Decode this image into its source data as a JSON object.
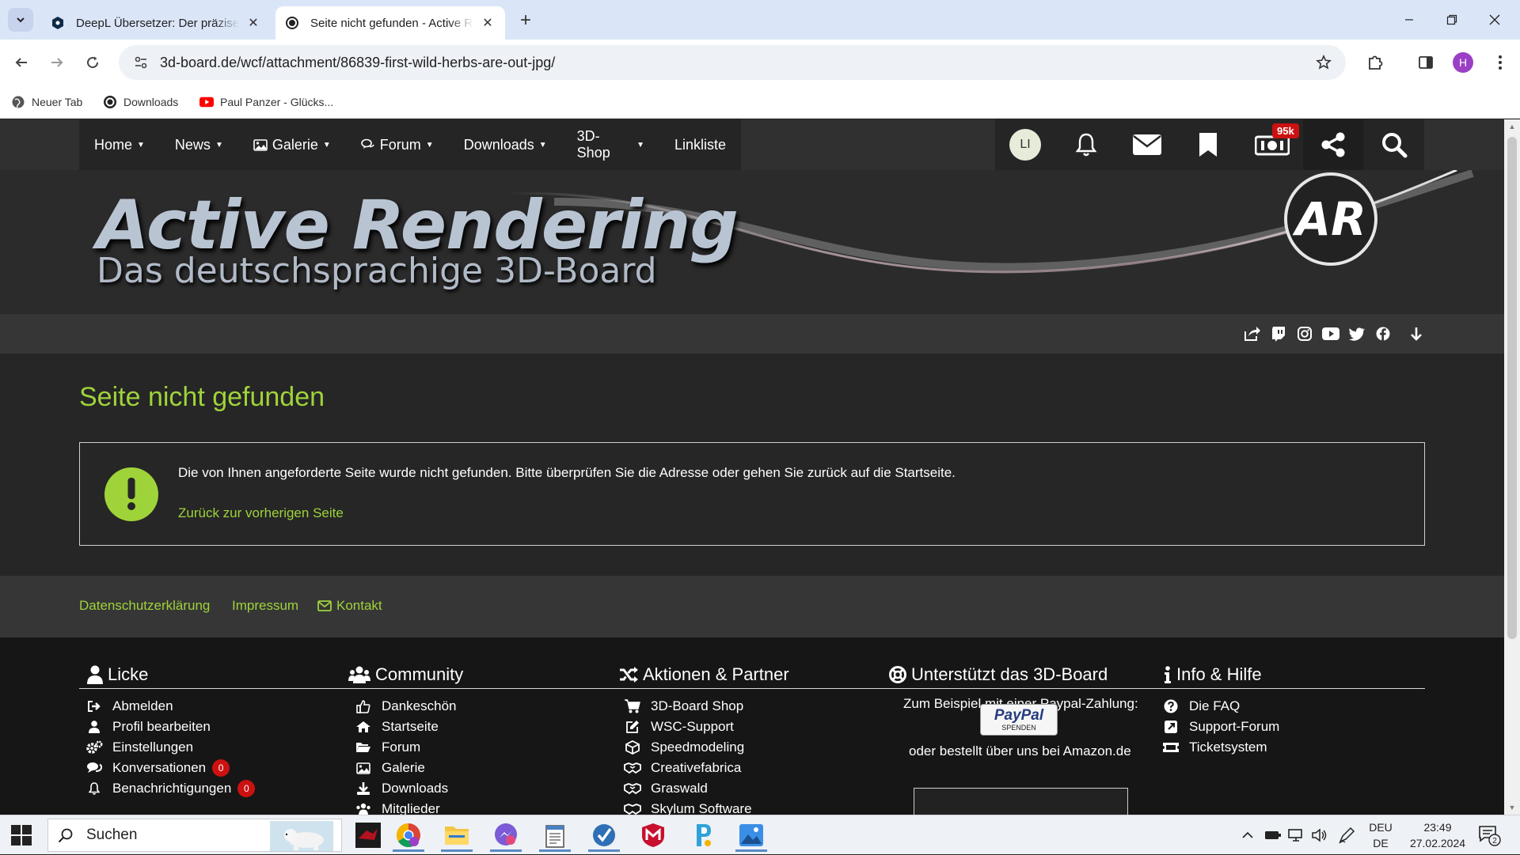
{
  "browser": {
    "tabs": [
      {
        "title": "DeepL Übersetzer: Der präziseste",
        "active": false
      },
      {
        "title": "Seite nicht gefunden - Active Rendering",
        "active": true
      }
    ],
    "url": "3d-board.de/wcf/attachment/86839-first-wild-herbs-are-out-jpg/",
    "profile_initial": "H",
    "bookmarks": [
      {
        "label": "Neuer Tab",
        "icon": "globe-icon"
      },
      {
        "label": "Downloads",
        "icon": "site-icon"
      },
      {
        "label": "Paul Panzer - Glücks...",
        "icon": "youtube-icon"
      }
    ]
  },
  "site": {
    "nav": {
      "items": [
        {
          "label": "Home",
          "dropdown": true
        },
        {
          "label": "News",
          "dropdown": true
        },
        {
          "label": "Galerie",
          "dropdown": true,
          "icon": "image-icon"
        },
        {
          "label": "Forum",
          "dropdown": true,
          "icon": "comments-icon"
        },
        {
          "label": "Downloads",
          "dropdown": true
        },
        {
          "label": "3D-Shop",
          "dropdown": true
        },
        {
          "label": "Linkliste",
          "dropdown": false
        }
      ],
      "user_initials": "LI",
      "badge_count": "95k"
    },
    "banner": {
      "title": "Active Rendering",
      "subtitle": "Das deutschsprachige 3D-Board",
      "logo": "AR"
    },
    "page_title": "Seite nicht gefunden",
    "error": {
      "message": "Die von Ihnen angeforderte Seite wurde nicht gefunden. Bitte überprüfen Sie die Adresse oder gehen Sie zurück auf die Startseite.",
      "back_link": "Zurück zur vorherigen Seite"
    },
    "footer_links": {
      "privacy": "Datenschutzerklärung",
      "imprint": "Impressum",
      "contact": "Kontakt"
    },
    "footer": {
      "user": {
        "title": "Licke",
        "items": [
          {
            "label": "Abmelden"
          },
          {
            "label": "Profil bearbeiten"
          },
          {
            "label": "Einstellungen"
          },
          {
            "label": "Konversationen",
            "badge": "0"
          },
          {
            "label": "Benachrichtigungen",
            "badge": "0"
          }
        ]
      },
      "community": {
        "title": "Community",
        "items": [
          "Dankeschön",
          "Startseite",
          "Forum",
          "Galerie",
          "Downloads",
          "Mitglieder"
        ]
      },
      "partner": {
        "title": "Aktionen & Partner",
        "items": [
          "3D-Board Shop",
          "WSC-Support",
          "Speedmodeling",
          "Creativefabrica",
          "Graswald",
          "Skylum Software"
        ]
      },
      "support": {
        "title": "Unterstützt das 3D-Board",
        "paypal_text": "Zum Beispiel mit einer Paypal-Zahlung:",
        "paypal_logo": "PayPal",
        "paypal_sub": "SPENDEN",
        "amazon_text": "oder bestellt über uns bei Amazon.de"
      },
      "info": {
        "title": "Info & Hilfe",
        "items": [
          "Die FAQ",
          "Support-Forum",
          "Ticketsystem"
        ]
      }
    },
    "colors": {
      "accent": "#9fd33a",
      "background": "#262626",
      "badge": "#cc1111"
    }
  },
  "taskbar": {
    "search_label": "Suchen",
    "lang_top": "DEU",
    "lang_bottom": "DE",
    "time": "23:49",
    "date": "27.02.2024",
    "notification_count": "2"
  }
}
